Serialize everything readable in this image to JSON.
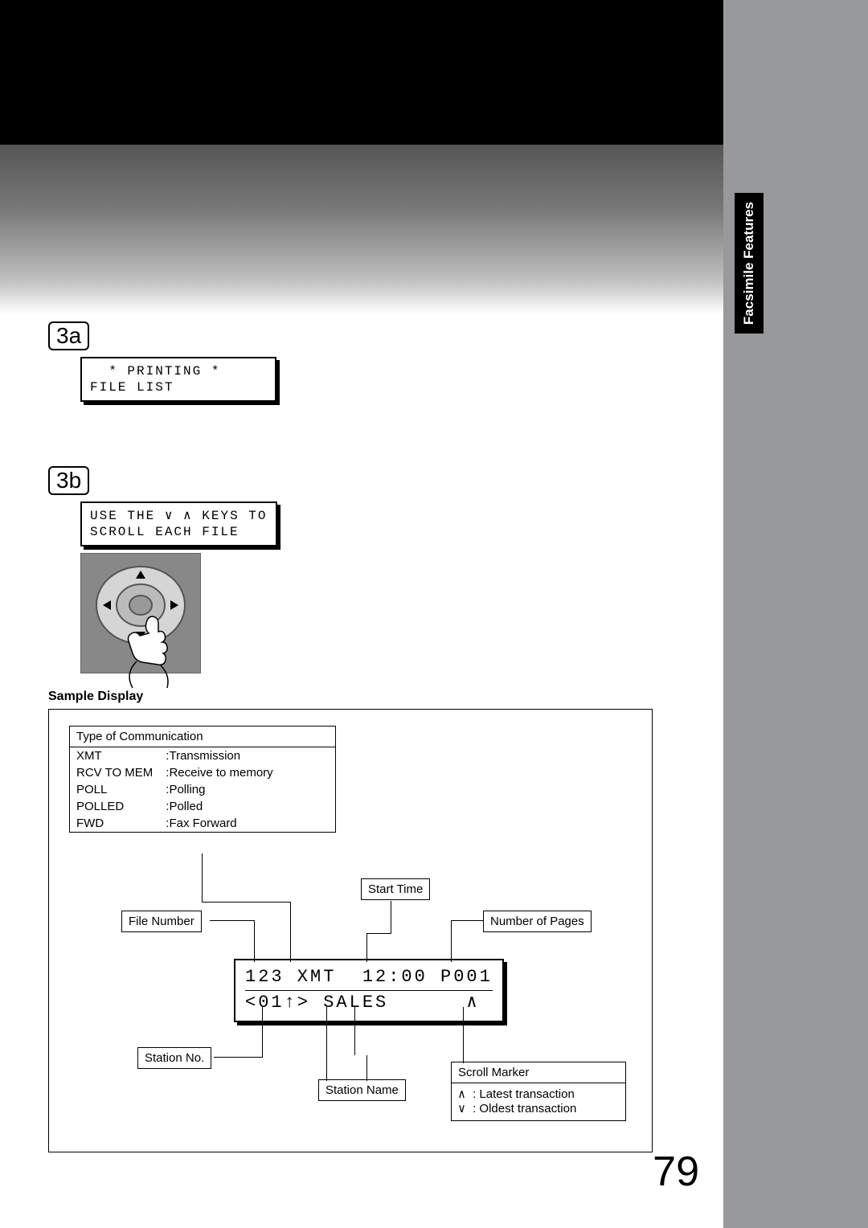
{
  "sideTab": "Facsimile Features",
  "step3a": {
    "label": "3a",
    "lcd": "  * PRINTING *\nFILE LIST"
  },
  "step3b": {
    "label": "3b",
    "lcd": "USE THE ∨ ∧ KEYS TO\nSCROLL EACH FILE"
  },
  "sampleHeading": "Sample Display",
  "commBox": {
    "title": "Type of Communication",
    "rows": [
      {
        "k": "XMT",
        "v": ":Transmission"
      },
      {
        "k": "RCV TO MEM",
        "v": ":Receive to memory"
      },
      {
        "k": "POLL",
        "v": ":Polling"
      },
      {
        "k": "POLLED",
        "v": ":Polled"
      },
      {
        "k": "FWD",
        "v": ":Fax Forward"
      }
    ]
  },
  "labels": {
    "fileNumber": "File Number",
    "startTime": "Start Time",
    "pages": "Number of Pages",
    "stationNo": "Station No.",
    "stationName": "Station Name",
    "scrollMarker": "Scroll Marker"
  },
  "scrollLegend": {
    "latest": ": Latest transaction",
    "oldest": ": Oldest transaction"
  },
  "display": {
    "line1": "123 XMT  12:00 P001",
    "line2": "<01↑> SALES      ∧"
  },
  "pageNumber": "79"
}
